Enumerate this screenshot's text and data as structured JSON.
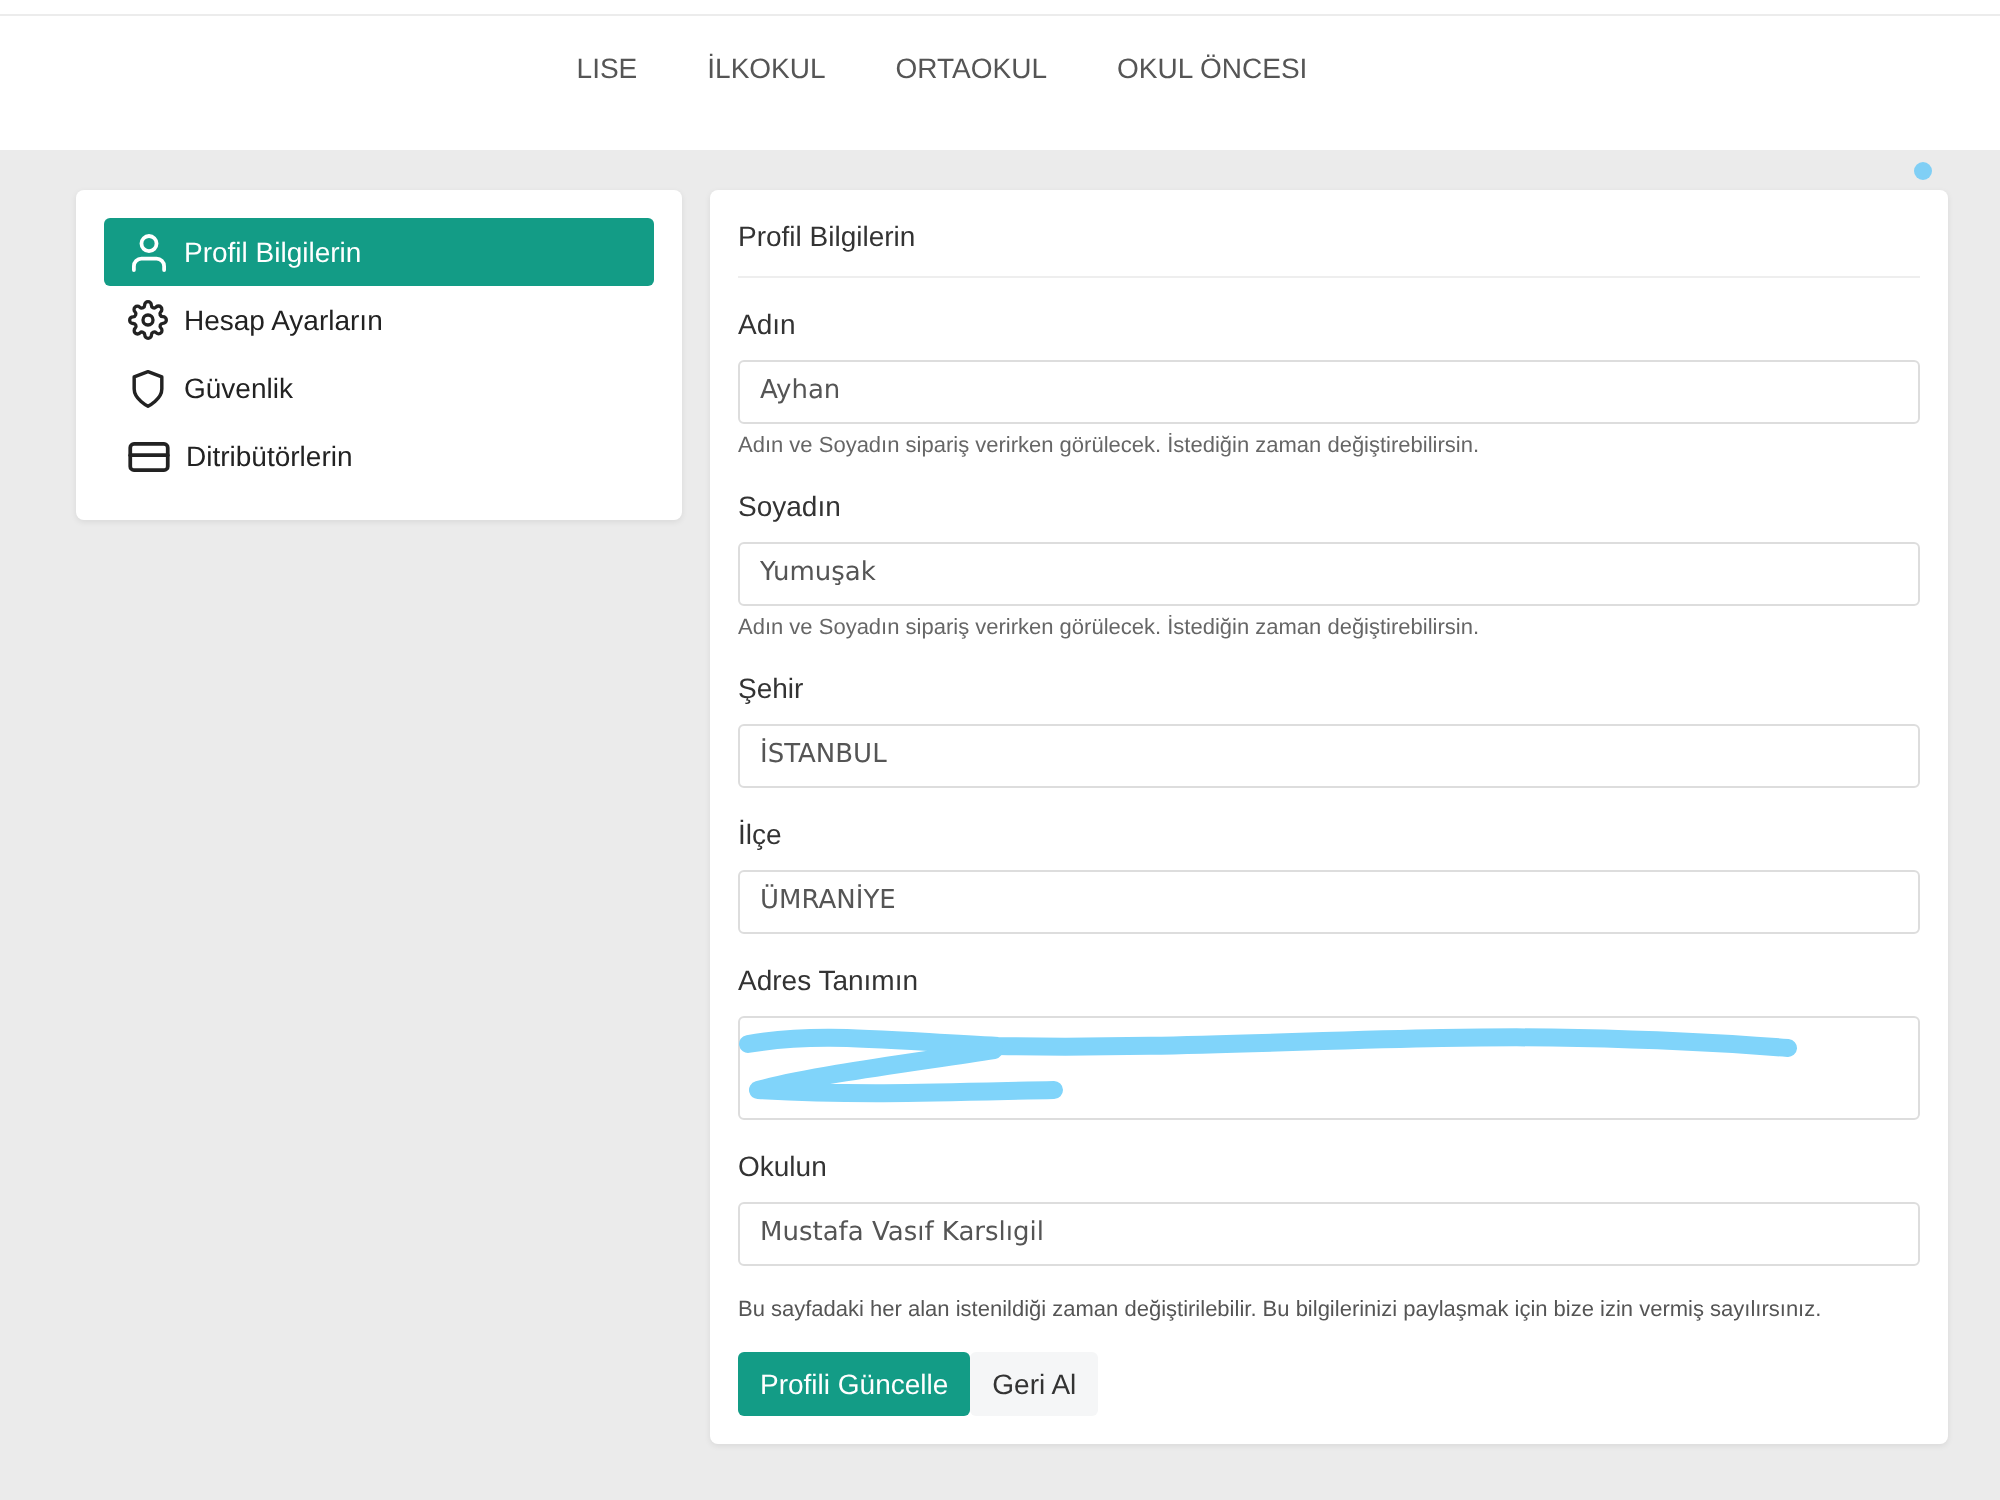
{
  "nav": {
    "items": [
      {
        "label": "LISE"
      },
      {
        "label": "İLKOKUL"
      },
      {
        "label": "ORTAOKUL"
      },
      {
        "label": "OKUL ÖNCESI"
      }
    ]
  },
  "sidebar": {
    "items": [
      {
        "label": "Profil Bilgilerin",
        "kind": "profile",
        "selected": true
      },
      {
        "label": "Hesap Ayarların",
        "kind": "settings",
        "selected": false
      },
      {
        "label": "Güvenlik",
        "kind": "security",
        "selected": false
      },
      {
        "label": "Ditribütörlerin",
        "kind": "card",
        "selected": false
      }
    ]
  },
  "form": {
    "title": "Profil Bilgilerin",
    "fields": [
      {
        "label": "Adın",
        "kind": "input",
        "value": "Ayhan",
        "hint": "Adın ve Soyadın sipariş verirken görülecek. İstediğin zaman değiştirebilirsin."
      },
      {
        "label": "Soyadın",
        "kind": "input",
        "value": "Yumuşak",
        "hint": "Adın ve Soyadın sipariş verirken görülecek. İstediğin zaman değiştirebilirsin."
      },
      {
        "label": "Şehir",
        "kind": "input",
        "value": "İSTANBUL"
      },
      {
        "label": "İlçe",
        "kind": "input",
        "value": "ÜMRANİYE"
      },
      {
        "label": "Adres Tanımın",
        "kind": "textarea",
        "redacted": true
      },
      {
        "label": "Okulun",
        "kind": "input",
        "value": "Mustafa Vasıf Karslıgil"
      }
    ],
    "note": "Bu sayfadaki her alan istenildiği zaman değiştirilebilir. Bu bilgilerinizi paylaşmak için bize izin vermiş sayılırsınız.",
    "buttons": [
      {
        "label": "Profili Güncelle",
        "kind": "primary"
      },
      {
        "label": "Geri Al",
        "kind": "secondary"
      }
    ]
  }
}
